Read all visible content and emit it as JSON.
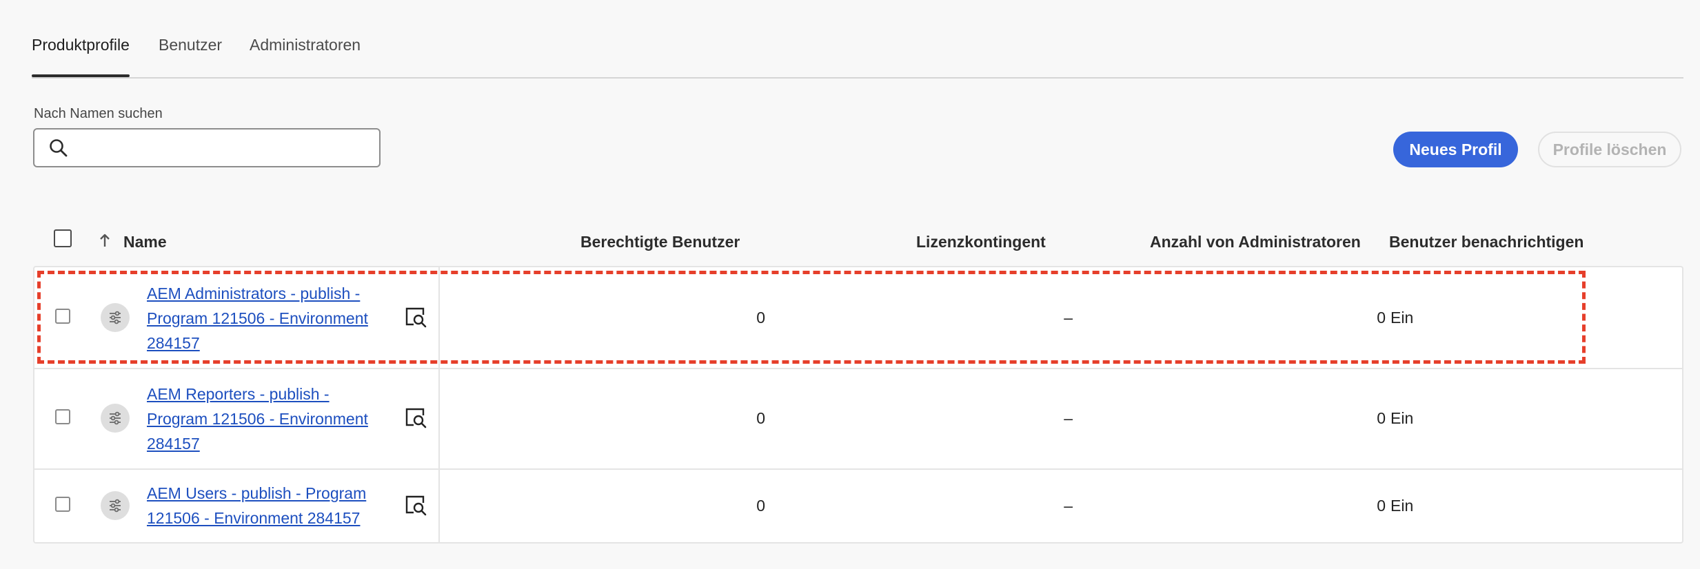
{
  "tabs": [
    {
      "label": "Produktprofile",
      "active": true
    },
    {
      "label": "Benutzer",
      "active": false
    },
    {
      "label": "Administratoren",
      "active": false
    }
  ],
  "search": {
    "label": "Nach Namen suchen",
    "value": "",
    "placeholder": ""
  },
  "actions": {
    "new_profile": "Neues Profil",
    "delete_profiles": "Profile löschen"
  },
  "table": {
    "headers": {
      "name": "Name",
      "entitled_users": "Berechtigte Benutzer",
      "license_quota": "Lizenzkontingent",
      "admin_count": "Anzahl von Administratoren",
      "notify_users": "Benutzer benachrichtigen"
    },
    "sort": {
      "column": "name",
      "direction": "ascending"
    },
    "rows": [
      {
        "name": "AEM Administrators - publish - Program 121506 - Environment 284157",
        "entitled_users": "0",
        "license_quota": "–",
        "admin_count": "0",
        "notify_users": "Ein",
        "highlighted": true
      },
      {
        "name": "AEM Reporters - publish - Program 121506 - Environment 284157",
        "entitled_users": "0",
        "license_quota": "–",
        "admin_count": "0",
        "notify_users": "Ein",
        "highlighted": false
      },
      {
        "name": "AEM Users - publish - Program 121506 - Environment 284157",
        "entitled_users": "0",
        "license_quota": "–",
        "admin_count": "0",
        "notify_users": "Ein",
        "highlighted": false
      }
    ]
  },
  "colors": {
    "accent": "#3766db",
    "link": "#1d4fbf",
    "highlight": "#e63f2b"
  },
  "icons": {
    "search": "search-icon",
    "sort": "arrow-up-icon",
    "profile": "settings-sliders-icon",
    "details": "view-details-icon"
  }
}
